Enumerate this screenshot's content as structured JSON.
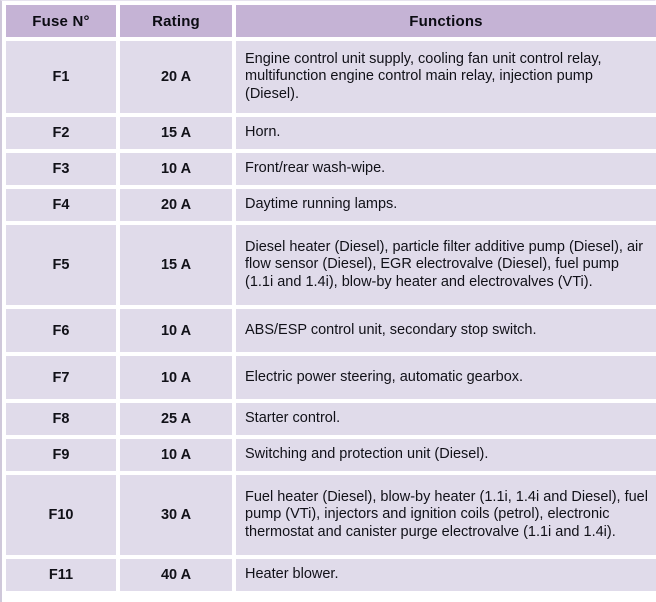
{
  "table": {
    "columns": [
      {
        "key": "fuse",
        "label": "Fuse N°"
      },
      {
        "key": "rating",
        "label": "Rating"
      },
      {
        "key": "function",
        "label": "Functions"
      }
    ],
    "colors": {
      "header_background": "#c5b3d5",
      "cell_background": "#e0dbea",
      "text": "#111118",
      "gap": "#ffffff",
      "frame_border": "#cfc8da"
    },
    "rows": [
      {
        "fuse": "F1",
        "rating": "20 A",
        "function": "Engine control unit supply, cooling fan unit control relay, multifunction engine control main relay, injection pump (Diesel)."
      },
      {
        "fuse": "F2",
        "rating": "15 A",
        "function": "Horn."
      },
      {
        "fuse": "F3",
        "rating": "10 A",
        "function": "Front/rear wash-wipe."
      },
      {
        "fuse": "F4",
        "rating": "20 A",
        "function": "Daytime running lamps."
      },
      {
        "fuse": "F5",
        "rating": "15 A",
        "function": "Diesel heater (Diesel), particle filter additive pump (Diesel), air flow sensor (Diesel), EGR electrovalve (Diesel), fuel pump (1.1i and 1.4i), blow-by heater and electrovalves (VTi)."
      },
      {
        "fuse": "F6",
        "rating": "10 A",
        "function": "ABS/ESP control unit, secondary stop switch."
      },
      {
        "fuse": "F7",
        "rating": "10 A",
        "function": "Electric power steering, automatic gearbox."
      },
      {
        "fuse": "F8",
        "rating": "25 A",
        "function": "Starter control."
      },
      {
        "fuse": "F9",
        "rating": "10 A",
        "function": "Switching and protection unit (Diesel)."
      },
      {
        "fuse": "F10",
        "rating": "30 A",
        "function": "Fuel heater (Diesel), blow-by heater (1.1i, 1.4i and Diesel), fuel pump (VTi), injectors and ignition coils (petrol), electronic thermostat and canister purge electrovalve (1.1i and 1.4i)."
      },
      {
        "fuse": "F11",
        "rating": "40 A",
        "function": "Heater blower."
      }
    ]
  }
}
